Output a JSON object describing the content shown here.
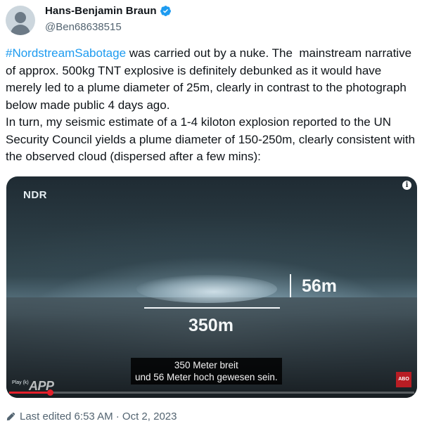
{
  "author": {
    "display_name": "Hans-Benjamin Braun",
    "handle": "@Ben68638515",
    "verified": true
  },
  "tweet": {
    "hashtag": "#NordstreamSabotage",
    "body": " was carried out by a nuke. The  mainstream narrative of approx. 500kg TNT explosive is definitely debunked as it would have merely led to a plume diameter of 25m, clearly in contrast to the photograph below made public 4 days ago.\nIn turn, my seismic estimate of a 1-4 kiloton explosion reported to the UN Security Council yields a plume diameter of 150-250m, clearly consistent with the observed cloud (dispersed after a few mins):"
  },
  "media": {
    "channel_logo": "NDR",
    "info_icon": "i",
    "width_label": "350m",
    "height_label": "56m",
    "subtitle_line1": "350 Meter breit",
    "subtitle_line2": "und 56 Meter hoch gewesen sein.",
    "play_label": "Play (k)",
    "app_logo": "APP",
    "badge": "ABO",
    "progress_fraction": 0.1,
    "accent_color": "#e5202b"
  },
  "footer": {
    "edited_text": "Last edited 6:53 AM · Oct 2, 2023"
  },
  "colors": {
    "hashtag": "#1d9bf0",
    "secondary_text": "#536471",
    "verified_badge": "#1d9bf0"
  }
}
